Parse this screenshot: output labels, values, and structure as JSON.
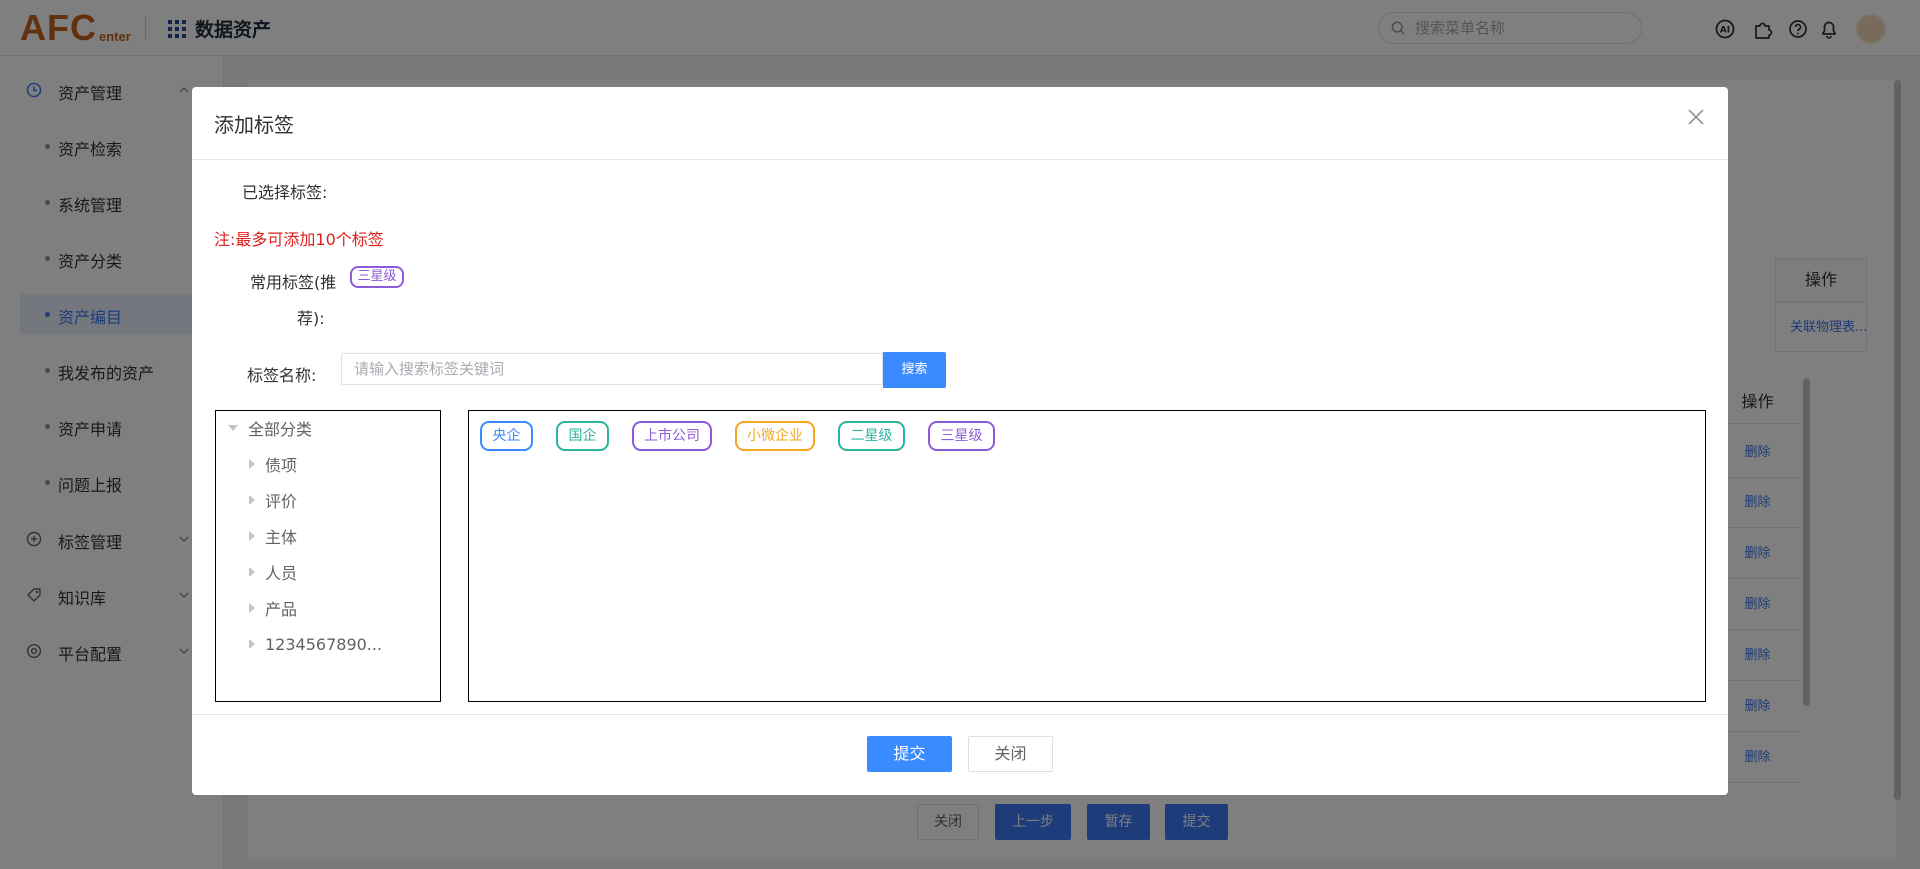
{
  "header": {
    "logo_big": "AFC",
    "logo_small": "enter",
    "app_title": "数据资产",
    "search_placeholder": "搜索菜单名称",
    "icons": [
      "ai-icon",
      "puzzle-icon",
      "help-icon",
      "bell-icon",
      "avatar"
    ]
  },
  "sidebar": {
    "groups": [
      {
        "label": "资产管理",
        "icon": "clock-icon",
        "expanded": true
      },
      {
        "label": "标签管理",
        "icon": "plus-circle-icon",
        "expanded": false
      },
      {
        "label": "知识库",
        "icon": "tag-icon",
        "expanded": false
      },
      {
        "label": "平台配置",
        "icon": "gear-icon",
        "expanded": false
      }
    ],
    "items": [
      {
        "label": "资产检索"
      },
      {
        "label": "系统管理"
      },
      {
        "label": "资产分类"
      },
      {
        "label": "资产编目",
        "active": true
      },
      {
        "label": "我发布的资产"
      },
      {
        "label": "资产申请"
      },
      {
        "label": "问题上报"
      }
    ]
  },
  "background_page": {
    "op_header": "操作",
    "link_text": "关联物理表...",
    "op_header_2": "操作",
    "delete_label": "删除",
    "buttons": {
      "close": "关闭",
      "prev": "上一步",
      "save": "暂存",
      "submit": "提交"
    }
  },
  "dialog": {
    "title": "添加标签",
    "selected_label": "已选择标签:",
    "note": "注:最多可添加10个标签",
    "common_label_line1": "常用标签(推",
    "common_label_line2": "荐):",
    "common_tag": "三星级",
    "name_label": "标签名称:",
    "search_placeholder": "请输入搜索标签关键词",
    "search_button": "搜索",
    "tree": {
      "root": "全部分类",
      "children": [
        "债项",
        "评价",
        "主体",
        "人员",
        "产品",
        "1234567890..."
      ]
    },
    "tags": [
      {
        "label": "央企",
        "color": "#3a8bff"
      },
      {
        "label": "国企",
        "color": "#2bb5a0"
      },
      {
        "label": "上市公司",
        "color": "#8e5cd9"
      },
      {
        "label": "小微企业",
        "color": "#f5a623"
      },
      {
        "label": "二星级",
        "color": "#2bb5a0"
      },
      {
        "label": "三星级",
        "color": "#8e5cd9"
      }
    ],
    "submit_button": "提交",
    "close_button": "关闭"
  },
  "colors": {
    "primary": "#3a8bff",
    "danger": "#e0201e",
    "brand": "#c4631a"
  }
}
